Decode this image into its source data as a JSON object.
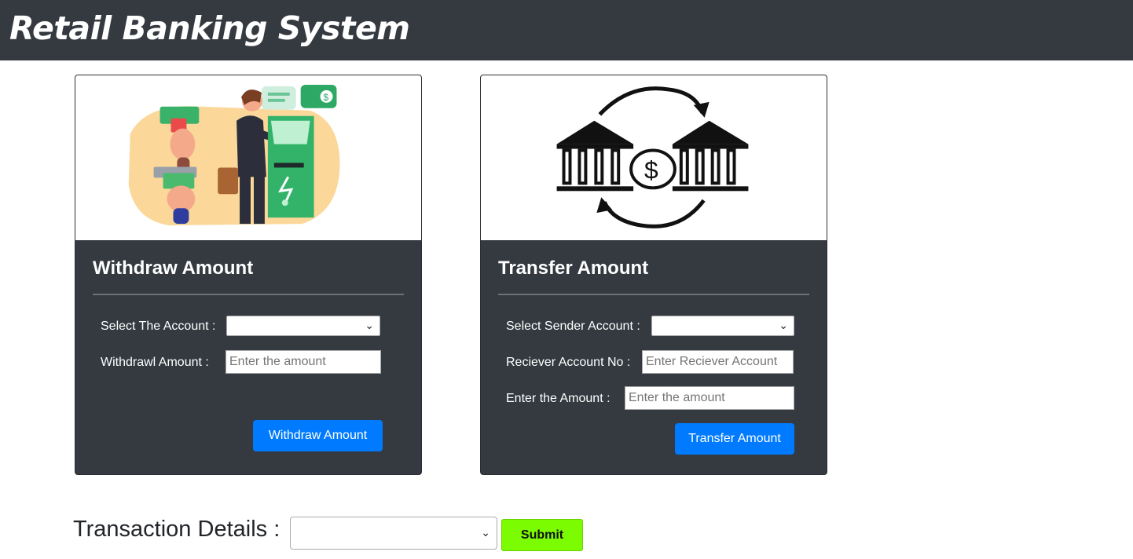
{
  "header": {
    "title": "Retail Banking System"
  },
  "withdraw_card": {
    "title": "Withdraw Amount",
    "account_label": "Select The Account :",
    "account_selected": "",
    "amount_label": "Withdrawl Amount :",
    "amount_placeholder": "Enter the amount",
    "amount_value": "",
    "button_label": "Withdraw Amount"
  },
  "transfer_card": {
    "title": "Transfer Amount",
    "sender_label": "Select Sender Account :",
    "sender_selected": "",
    "receiver_label": "Reciever Account No :",
    "receiver_placeholder": "Enter Reciever Account",
    "amount_label": "Enter the Amount :",
    "amount_placeholder": "Enter the amount",
    "button_label": "Transfer Amount"
  },
  "transaction_details": {
    "label": "Transaction Details :",
    "selected": "",
    "submit_label": "Submit"
  },
  "icons": {
    "dropdown": "chevron-down-icon",
    "withdraw_image": "atm-withdrawal-illustration",
    "transfer_image": "bank-transfer-illustration"
  },
  "colors": {
    "navbar": "#343a40",
    "card_body": "#343a40",
    "primary_button": "#007bff",
    "submit_button": "#7cfc00"
  }
}
